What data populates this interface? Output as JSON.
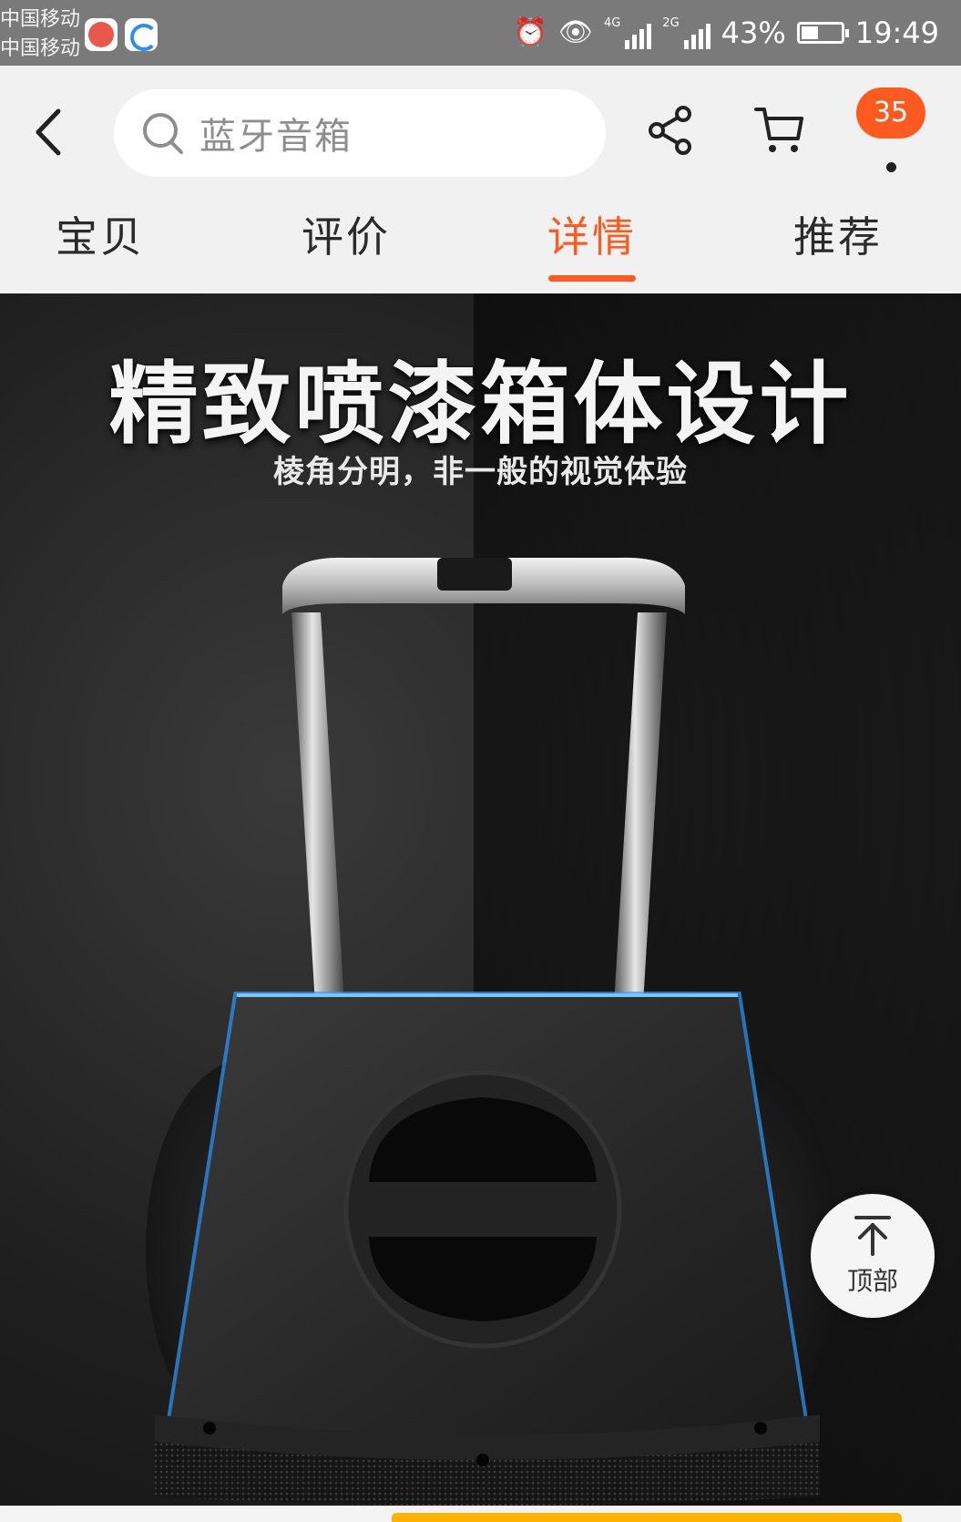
{
  "status_bar": {
    "carrier_1": "中国移动",
    "carrier_2": "中国移动",
    "network_1": "4G",
    "network_2": "2G",
    "battery": "43%",
    "battery_fraction": 0.43,
    "time": "19:49",
    "icons": [
      "app-icon-red",
      "app-icon-blue",
      "alarm-icon",
      "eye-icon",
      "signal-icon",
      "battery-icon"
    ]
  },
  "header": {
    "search_placeholder": "蓝牙音箱",
    "message_badge": "35",
    "icons": [
      "back-icon",
      "search-icon",
      "share-icon",
      "cart-icon"
    ]
  },
  "tabs": [
    {
      "label": "宝贝",
      "active": false
    },
    {
      "label": "评价",
      "active": false
    },
    {
      "label": "详情",
      "active": true
    },
    {
      "label": "推荐",
      "active": false
    }
  ],
  "hero": {
    "title": "精致喷漆箱体设计",
    "subtitle": "棱角分明，非一般的视觉体验"
  },
  "back_to_top": {
    "label": "顶部",
    "icon": "arrow-up-icon"
  },
  "colors": {
    "accent": "#ff5a1f",
    "status_bar": "#7a7a7a",
    "glow": "#2e9bff"
  }
}
